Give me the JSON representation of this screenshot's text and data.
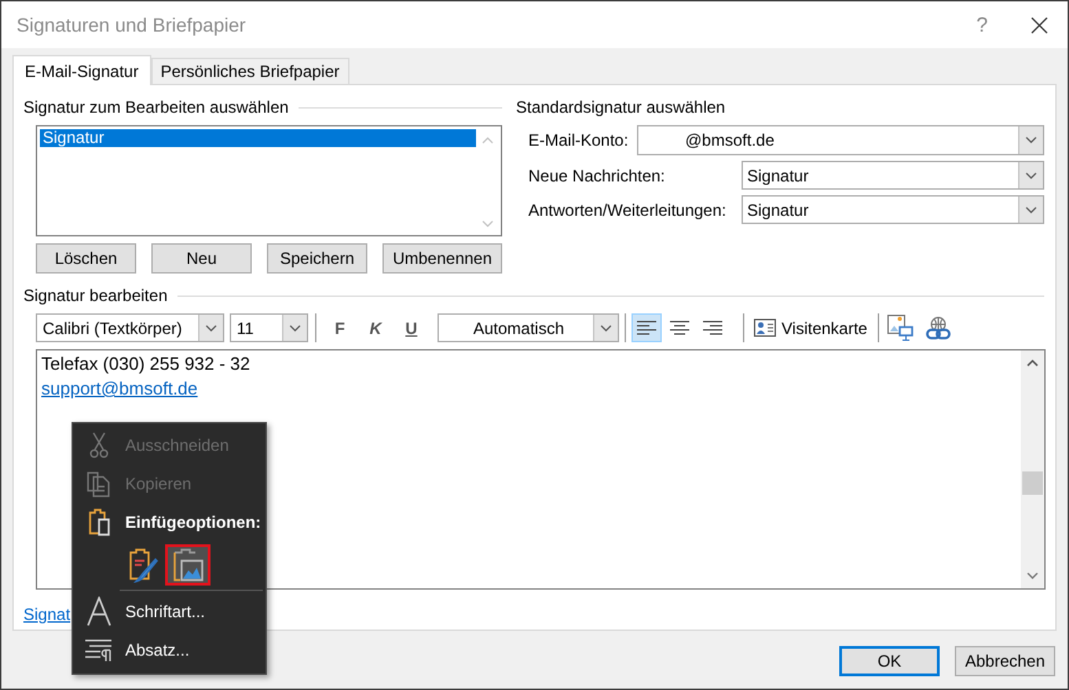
{
  "window": {
    "title": "Signaturen und Briefpapier",
    "help": "?"
  },
  "tabs": [
    {
      "label": "E-Mail-Signatur",
      "selected": true
    },
    {
      "label": "Persönliches Briefpapier",
      "selected": false
    }
  ],
  "select_signature": {
    "heading": "Signatur zum Bearbeiten auswählen",
    "items": [
      {
        "label": "Signatur",
        "selected": true
      }
    ],
    "buttons": [
      "Löschen",
      "Neu",
      "Speichern",
      "Umbenennen"
    ]
  },
  "default_signature": {
    "heading": "Standardsignatur auswählen",
    "fields": [
      {
        "label": "E-Mail-Konto:",
        "value": "@bmsoft.de"
      },
      {
        "label": "Neue Nachrichten:",
        "value": "Signatur"
      },
      {
        "label": "Antworten/Weiterleitungen:",
        "value": "Signatur"
      }
    ]
  },
  "edit_signature": {
    "heading": "Signatur bearbeiten",
    "toolbar": {
      "font": "Calibri (Textkörper)",
      "size": "11",
      "bold": "F",
      "italic": "K",
      "underline": "U",
      "font_color": "Automatisch",
      "alignments": [
        {
          "kind": "left",
          "selected": true
        },
        {
          "kind": "center",
          "selected": false
        },
        {
          "kind": "right",
          "selected": false
        }
      ],
      "business_card": "Visitenkarte"
    },
    "lines": [
      {
        "kind": "text",
        "text": "Telefax (030) 255 932 - 32"
      },
      {
        "kind": "link",
        "text": "support@bmsoft.de"
      }
    ]
  },
  "link": "Signat",
  "context_menu": {
    "items": [
      {
        "kind": "command",
        "label": "Ausschneiden",
        "disabled": true
      },
      {
        "kind": "command",
        "label": "Kopieren",
        "disabled": true
      },
      {
        "kind": "heading",
        "label": "Einfügeoptionen:"
      },
      {
        "kind": "options",
        "options": [
          {
            "selected": false
          },
          {
            "selected": true
          }
        ]
      },
      {
        "kind": "command",
        "label": "Schriftart...",
        "disabled": false
      },
      {
        "kind": "command",
        "label": "Absatz...",
        "disabled": false
      }
    ]
  },
  "buttons": [
    {
      "label": "OK",
      "default": true
    },
    {
      "label": "Abbrechen",
      "default": false
    }
  ]
}
